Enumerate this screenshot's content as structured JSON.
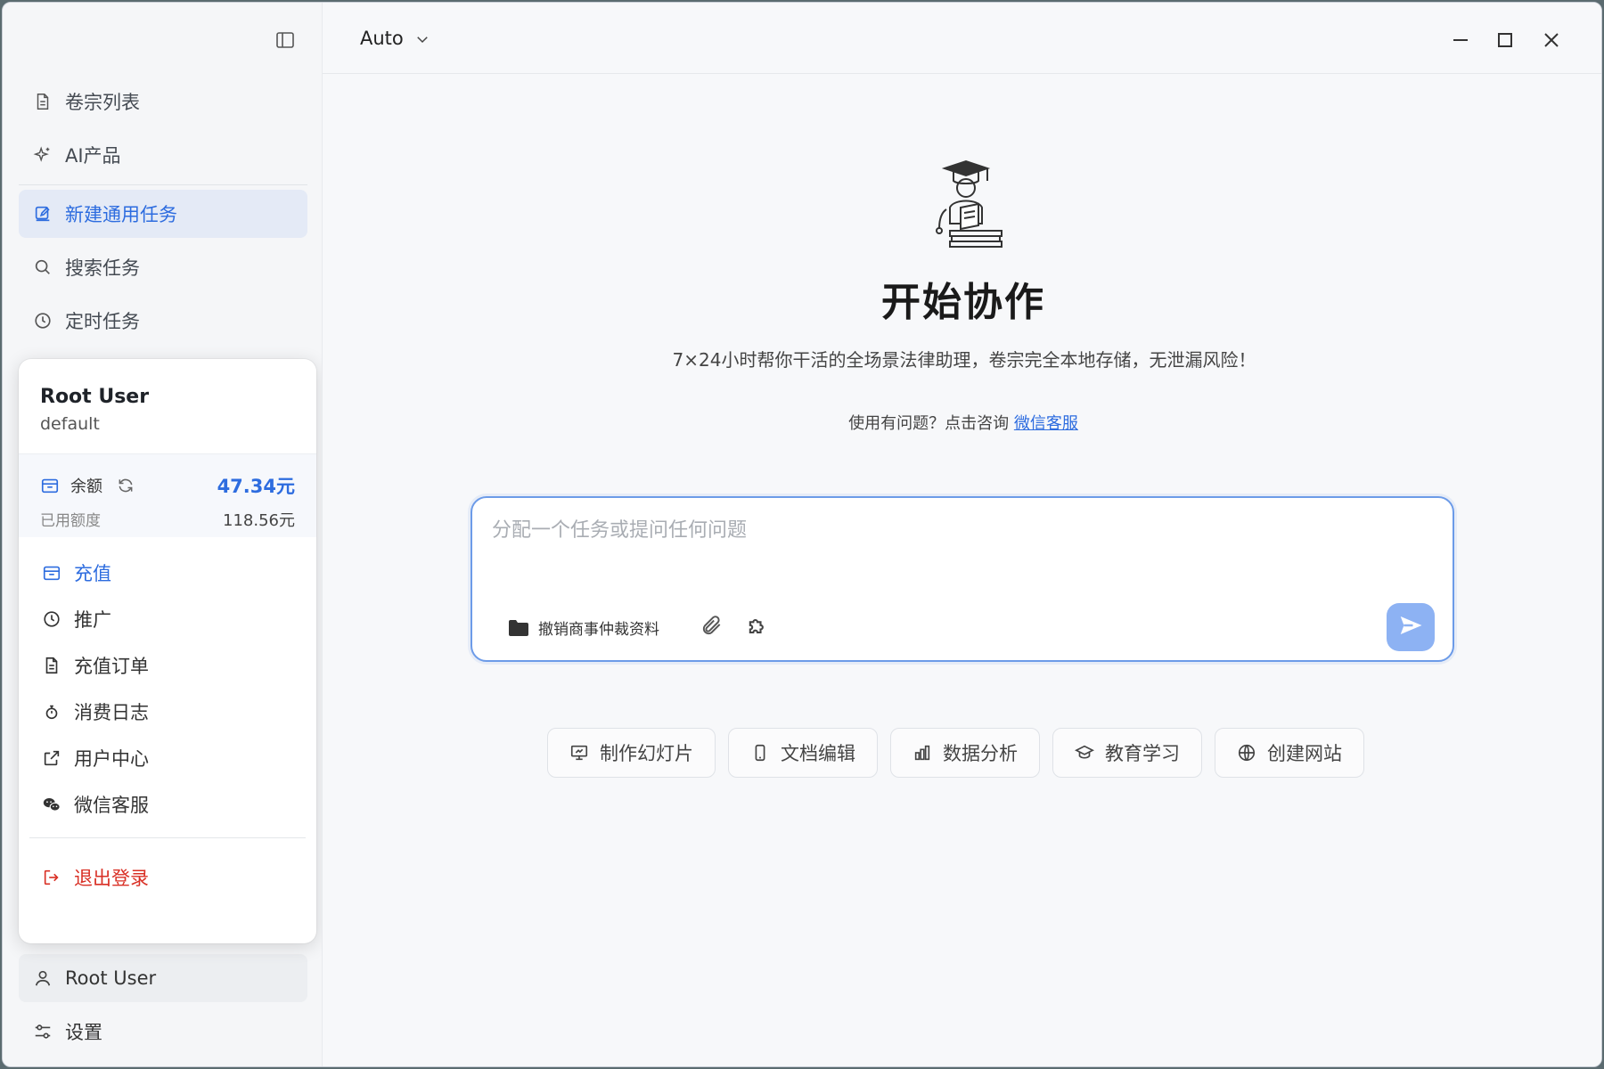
{
  "sidebar": {
    "nav": [
      {
        "label": "卷宗列表",
        "icon": "document-icon"
      },
      {
        "label": "AI产品",
        "icon": "sparkle-icon"
      },
      {
        "label": "新建通用任务",
        "icon": "edit-icon",
        "active": true
      },
      {
        "label": "搜索任务",
        "icon": "search-icon"
      },
      {
        "label": "定时任务",
        "icon": "clock-icon"
      }
    ],
    "bottom": [
      {
        "label": "Root User",
        "icon": "user-icon"
      },
      {
        "label": "设置",
        "icon": "settings-icon"
      }
    ]
  },
  "popup": {
    "name": "Root User",
    "group": "default",
    "balance_label": "余额",
    "balance_value": "47.34元",
    "used_label": "已用额度",
    "used_value": "118.56元",
    "items": [
      {
        "label": "充值",
        "icon": "wallet-icon"
      },
      {
        "label": "推广",
        "icon": "clock-icon"
      },
      {
        "label": "充值订单",
        "icon": "document-icon"
      },
      {
        "label": "消费日志",
        "icon": "stopwatch-icon"
      },
      {
        "label": "用户中心",
        "icon": "external-link-icon"
      },
      {
        "label": "微信客服",
        "icon": "wechat-icon"
      }
    ],
    "logout": "退出登录"
  },
  "topbar": {
    "model": "Auto"
  },
  "hero": {
    "title": "开始协作",
    "desc": "7×24小时帮你干活的全场景法律助理，卷宗完全本地存储，无泄漏风险！",
    "help_prefix": "使用有问题？点击咨询 ",
    "help_link": "微信客服"
  },
  "input": {
    "placeholder": "分配一个任务或提问任何问题",
    "value": "",
    "folder": "撤销商事仲裁资料"
  },
  "quick_actions": [
    {
      "label": "制作幻灯片",
      "icon": "presentation-icon"
    },
    {
      "label": "文档编辑",
      "icon": "phone-icon"
    },
    {
      "label": "数据分析",
      "icon": "bar-chart-icon"
    },
    {
      "label": "教育学习",
      "icon": "graduation-cap-icon"
    },
    {
      "label": "创建网站",
      "icon": "globe-icon"
    }
  ],
  "colors": {
    "accent": "#2d6cdf",
    "danger": "#d93025",
    "send": "#8db2f3"
  }
}
